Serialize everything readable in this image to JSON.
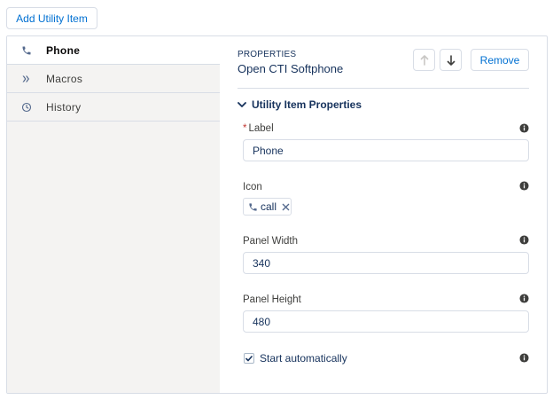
{
  "toolbar": {
    "add_label": "Add Utility Item"
  },
  "sidebar": {
    "items": [
      {
        "label": "Phone",
        "icon": "phone-icon",
        "active": true
      },
      {
        "label": "Macros",
        "icon": "macros-icon",
        "active": false
      },
      {
        "label": "History",
        "icon": "history-icon",
        "active": false
      }
    ]
  },
  "properties": {
    "caption": "PROPERTIES",
    "title": "Open CTI Softphone",
    "remove_label": "Remove",
    "section_title": "Utility Item Properties",
    "fields": {
      "label": {
        "label": "Label",
        "required_mark": "*",
        "value": "Phone"
      },
      "icon": {
        "label": "Icon",
        "value": "call"
      },
      "panel_width": {
        "label": "Panel Width",
        "value": "340"
      },
      "panel_height": {
        "label": "Panel Height",
        "value": "480"
      },
      "start_auto": {
        "label": "Start automatically",
        "checked": true
      }
    }
  },
  "colors": {
    "accent": "#0070d2",
    "sidebar_bg": "#f4f3f2",
    "border": "#d8dde6",
    "text": "#16325c"
  }
}
